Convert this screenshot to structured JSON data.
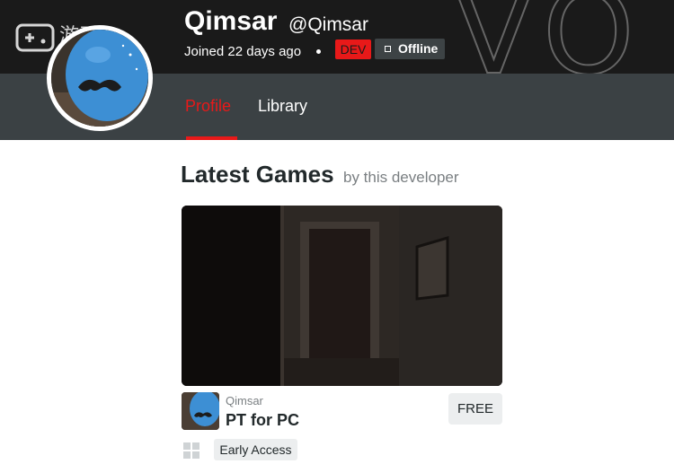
{
  "profile": {
    "display_name": "Qimsar",
    "handle": "@Qimsar",
    "joined": "Joined 22 days ago",
    "role_badge": "DEV",
    "status_badge": "Offline"
  },
  "watermark": {
    "text": "游研社"
  },
  "nav": {
    "tabs": [
      {
        "label": "Profile",
        "active": true
      },
      {
        "label": "Library",
        "active": false
      }
    ]
  },
  "section": {
    "title": "Latest Games",
    "subtitle": "by this developer"
  },
  "game": {
    "developer": "Qimsar",
    "title": "PT for PC",
    "price_label": "FREE",
    "tag": "Early Access",
    "platform_icon": "windows-icon"
  },
  "colors": {
    "accent_red": "#e81919",
    "banner_bg": "#1a1a1a",
    "nav_bg": "#3b4144",
    "text_dark": "#22292b",
    "text_muted": "#7a7f82",
    "chip_bg": "#eceeef"
  }
}
